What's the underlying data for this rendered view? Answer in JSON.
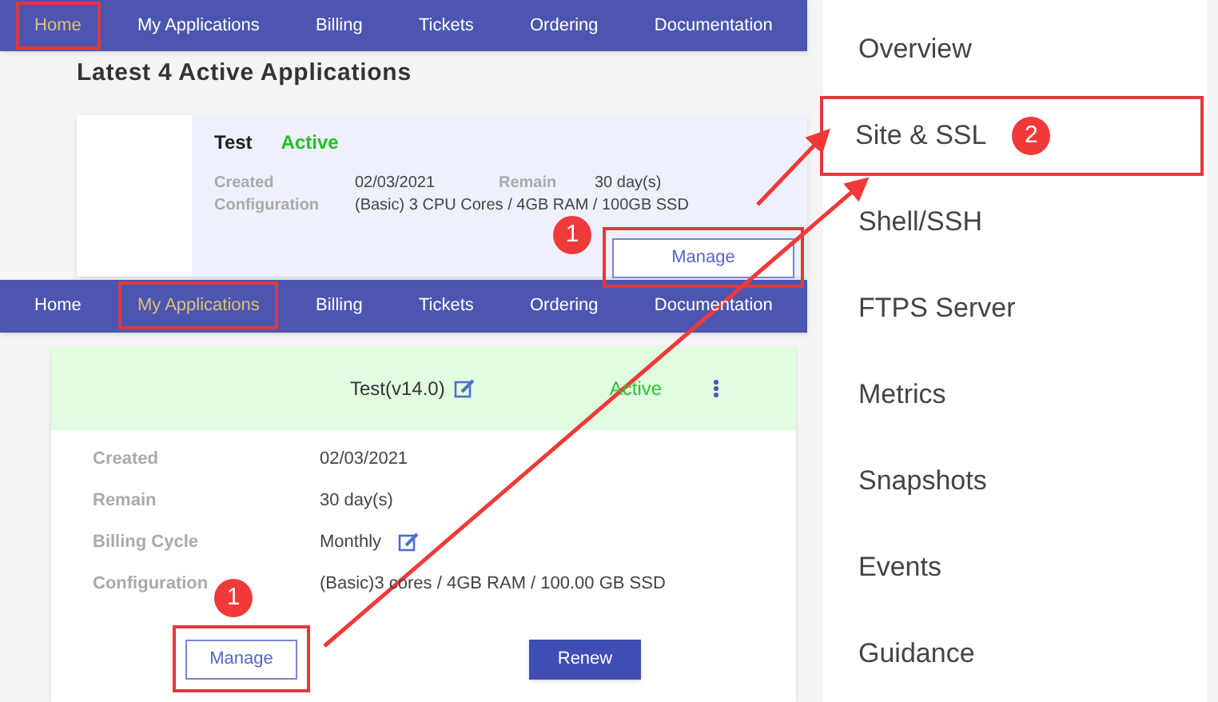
{
  "home_panel": {
    "nav": [
      {
        "label": "Home",
        "selected": true,
        "highlighted": true
      },
      {
        "label": "My Applications",
        "selected": false,
        "highlighted": false
      },
      {
        "label": "Billing",
        "selected": false,
        "highlighted": false
      },
      {
        "label": "Tickets",
        "selected": false,
        "highlighted": false
      },
      {
        "label": "Ordering",
        "selected": false,
        "highlighted": false
      },
      {
        "label": "Documentation",
        "selected": false,
        "highlighted": false
      }
    ],
    "heading": "Latest 4 Active Applications",
    "app": {
      "name": "Test",
      "status": "Active",
      "rows": [
        [
          {
            "label": "Created",
            "value": "02/03/2021"
          },
          {
            "label": "Remain",
            "value": "30 day(s)"
          }
        ],
        [
          {
            "label": "Configuration",
            "value": "(Basic) 3 CPU Cores / 4GB RAM / 100GB SSD"
          }
        ]
      ],
      "button": {
        "label": "Manage",
        "highlighted": true,
        "step": "1"
      }
    }
  },
  "applications_panel": {
    "nav": [
      {
        "label": "Home",
        "selected": false,
        "highlighted": false
      },
      {
        "label": "My Applications",
        "selected": true,
        "highlighted": true
      },
      {
        "label": "Billing",
        "selected": false,
        "highlighted": false
      },
      {
        "label": "Tickets",
        "selected": false,
        "highlighted": false
      },
      {
        "label": "Ordering",
        "selected": false,
        "highlighted": false
      },
      {
        "label": "Documentation",
        "selected": false,
        "highlighted": false
      }
    ],
    "app": {
      "name": "Test(v14.0)",
      "status": "Active",
      "fields": [
        {
          "label": "Created",
          "value": "02/03/2021",
          "editable": false
        },
        {
          "label": "Remain",
          "value": "30 day(s)",
          "editable": false
        },
        {
          "label": "Billing Cycle",
          "value": "Monthly",
          "editable": true
        },
        {
          "label": "Configuration",
          "value": "(Basic)3 cores / 4GB RAM / 100.00 GB SSD",
          "editable": false
        }
      ],
      "buttons": [
        {
          "label": "Manage",
          "kind": "outline",
          "highlighted": true,
          "step": "1"
        },
        {
          "label": "Renew",
          "kind": "filled",
          "highlighted": false
        }
      ]
    }
  },
  "manage_menu": {
    "items": [
      {
        "label": "Overview",
        "highlighted": false
      },
      {
        "label": "Site & SSL",
        "highlighted": true,
        "step": "2"
      },
      {
        "label": "Shell/SSH",
        "highlighted": false
      },
      {
        "label": "FTPS Server",
        "highlighted": false
      },
      {
        "label": "Metrics",
        "highlighted": false
      },
      {
        "label": "Snapshots",
        "highlighted": false
      },
      {
        "label": "Events",
        "highlighted": false
      },
      {
        "label": "Guidance",
        "highlighted": false
      }
    ]
  }
}
